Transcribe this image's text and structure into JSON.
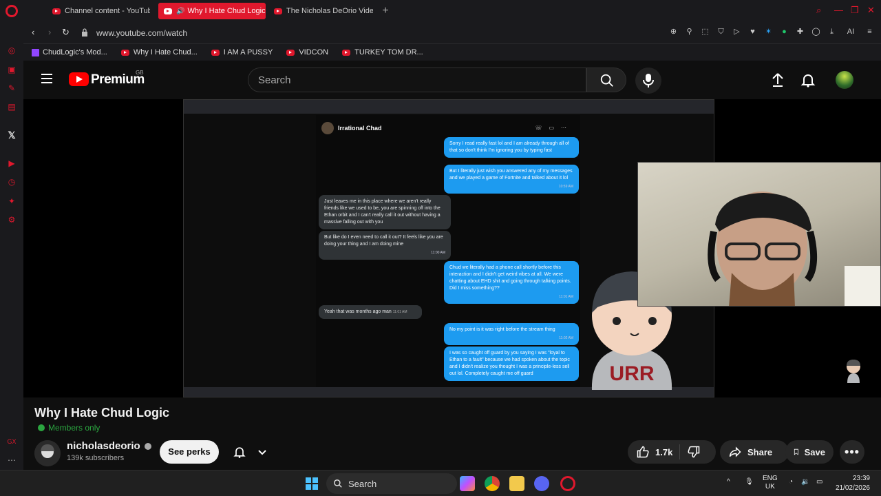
{
  "browser": {
    "tabs": [
      {
        "label": "Channel content - YouTube",
        "active": false
      },
      {
        "label": "Why I Hate Chud Logic",
        "active": true
      },
      {
        "label": "The Nicholas DeOrio Video",
        "active": false
      }
    ],
    "url": "www.youtube.com/watch",
    "bookmarks": [
      {
        "label": "ChudLogic's Mod...",
        "icon": "twitch-icon"
      },
      {
        "label": "Why I Hate Chud...",
        "icon": "youtube-icon"
      },
      {
        "label": "I AM A PUSSY",
        "icon": "youtube-icon"
      },
      {
        "label": "VIDCON",
        "icon": "youtube-icon"
      },
      {
        "label": "TURKEY TOM DR...",
        "icon": "youtube-icon"
      }
    ],
    "accent_color": "#e0182d"
  },
  "youtube": {
    "brand": "Premium",
    "region": "GB",
    "search_placeholder": "Search"
  },
  "video_frame": {
    "dm_contact": "Irrational Chad",
    "messages": [
      {
        "from": "me",
        "text": "Sorry I read really fast lol and I am already through all of that so don't think I'm ignoring you by typing fast",
        "time": ""
      },
      {
        "from": "me",
        "text": "But I literally just wish you answered any of my messages and we played a game of Fortnite and talked about it lol",
        "time": "10:59 AM"
      },
      {
        "from": "them",
        "text": "Just leaves me in this place where we aren't really friends like we used to be, you are spinning off into the Ethan orbit and I can't really call it out without having a massive falling out with you",
        "time": ""
      },
      {
        "from": "them",
        "text": "But like do I even need to call it out? It feels like you are doing your thing and I am doing mine",
        "time": "11:00 AM"
      },
      {
        "from": "me",
        "text": "Chud we literally had a phone call shortly before this interaction and I didn't get weird vibes at all. We were chatting about EHD shit and going through talking points. Did I miss something??",
        "time": "11:01 AM"
      },
      {
        "from": "them",
        "text": "Yeah that was months ago man",
        "time": "11:01 AM"
      },
      {
        "from": "me",
        "text": "No my point is it was right before the stream thing",
        "time": "11:02 AM"
      },
      {
        "from": "me",
        "text": "I was so caught off guard by you saying I was \"loyal to Ethan to a fault\" because we had spoken about the topic and I didn't realize you thought I was a principle-less sell out lol. Completely caught me off guard",
        "time": ""
      }
    ],
    "mascot_text": "URR"
  },
  "video": {
    "title": "Why I Hate Chud Logic",
    "members_label": "Members only",
    "channel_name": "nicholasdeorio",
    "subscribers": "139k subscribers",
    "perks_label": "See perks",
    "likes": "1.7k",
    "share_label": "Share",
    "save_label": "Save"
  },
  "taskbar": {
    "search_label": "Search",
    "lang_top": "ENG",
    "lang_bottom": "UK",
    "time": "23:39",
    "date": "21/02/2026"
  }
}
